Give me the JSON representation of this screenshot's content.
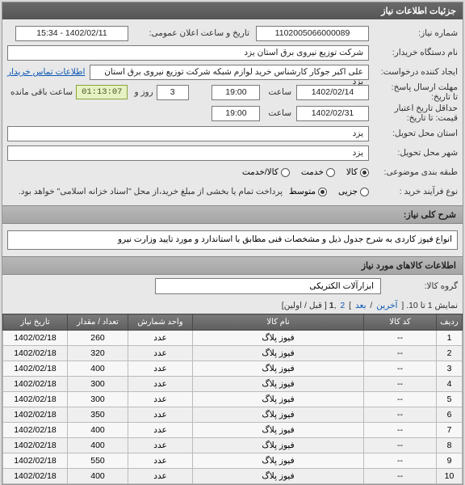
{
  "header": {
    "title": "جزئیات اطلاعات نیاز"
  },
  "fields": {
    "need_no_label": "شماره نیاز:",
    "need_no": "1102005066000089",
    "announce_label": "تاریخ و ساعت اعلان عمومی:",
    "announce_value": "1402/02/11 - 15:34",
    "buyer_org_label": "نام دستگاه خریدار:",
    "buyer_org": "شرکت توزیع نیروی برق استان یزد",
    "requester_label": "ایجاد کننده درخواست:",
    "requester": "علی اکبر جوکار  کارشناس خرید لوازم شبکه  شرکت توزیع نیروی برق استان یزد",
    "buyer_contact_link": "اطلاعات تماس خریدار",
    "deadline_send_label": "مهلت ارسال پاسخ:",
    "deadline_label1": "تا تاریخ:",
    "deadline_date": "1402/02/14",
    "time_label": "ساعت",
    "deadline_time": "19:00",
    "day_and": "روز و",
    "remaining_label": "ساعت باقی مانده",
    "remaining_days": "3",
    "countdown": "01:13:07",
    "price_validity_label": "حداقل تاریخ اعتبار",
    "price_validity_label2": "قیمت:",
    "price_validity_until": "تا تاریخ:",
    "price_validity_date": "1402/02/31",
    "price_validity_time": "19:00",
    "province_label": "استان محل تحویل:",
    "province": "یزد",
    "city_label": "شهر محل تحویل:",
    "city": "یزد",
    "category_label": "طبقه بندی موضوعی:",
    "cat_goods": "کالا",
    "cat_service": "خدمت",
    "cat_both": "کالا/خدمت",
    "process_label": "نوع فرآیند خرید :",
    "proc_low": "جزیی",
    "proc_med": "متوسط",
    "payment_note": "پرداخت تمام یا بخشی از مبلغ خرید،از محل \"اسناد خزانه اسلامی\" خواهد بود."
  },
  "summary": {
    "title": "شرح کلی نیاز:",
    "text": "انواع فیوز کاردی   به شرح جدول ذیل و مشخصات فنی   مطابق با استاندارد و مورد تایید وزارت نیرو"
  },
  "goods_section": {
    "title": "اطلاعات کالاهای مورد نیاز",
    "group_label": "گروه کالا:",
    "group_value": "ابزارآلات الکتریکی"
  },
  "pager": {
    "prefix": "نمایش 1 تا 10. [ ",
    "last": "آخرین",
    "sep1": " / ",
    "next": "بعد",
    "mid": " ] ",
    "p2": "2",
    "comma": " ,",
    "p1": "1",
    "suffix": " [ قبل / اولین]"
  },
  "table": {
    "headers": {
      "idx": "ردیف",
      "code": "کد کالا",
      "name": "نام کالا",
      "unit": "واحد شمارش",
      "qty": "تعداد / مقدار",
      "date": "تاریخ نیاز"
    },
    "rows": [
      {
        "idx": "1",
        "code": "--",
        "name": "فیوز پلاگ",
        "unit": "عدد",
        "qty": "260",
        "date": "1402/02/18"
      },
      {
        "idx": "2",
        "code": "--",
        "name": "فیوز پلاگ",
        "unit": "عدد",
        "qty": "320",
        "date": "1402/02/18"
      },
      {
        "idx": "3",
        "code": "--",
        "name": "فیوز پلاگ",
        "unit": "عدد",
        "qty": "400",
        "date": "1402/02/18"
      },
      {
        "idx": "4",
        "code": "--",
        "name": "فیوز پلاگ",
        "unit": "عدد",
        "qty": "300",
        "date": "1402/02/18"
      },
      {
        "idx": "5",
        "code": "--",
        "name": "فیوز پلاگ",
        "unit": "عدد",
        "qty": "300",
        "date": "1402/02/18"
      },
      {
        "idx": "6",
        "code": "--",
        "name": "فیوز پلاگ",
        "unit": "عدد",
        "qty": "350",
        "date": "1402/02/18"
      },
      {
        "idx": "7",
        "code": "--",
        "name": "فیوز پلاگ",
        "unit": "عدد",
        "qty": "400",
        "date": "1402/02/18"
      },
      {
        "idx": "8",
        "code": "--",
        "name": "فیوز پلاگ",
        "unit": "عدد",
        "qty": "400",
        "date": "1402/02/18"
      },
      {
        "idx": "9",
        "code": "--",
        "name": "فیوز پلاگ",
        "unit": "عدد",
        "qty": "550",
        "date": "1402/02/18"
      },
      {
        "idx": "10",
        "code": "--",
        "name": "فیوز پلاگ",
        "unit": "عدد",
        "qty": "400",
        "date": "1402/02/18"
      }
    ]
  }
}
